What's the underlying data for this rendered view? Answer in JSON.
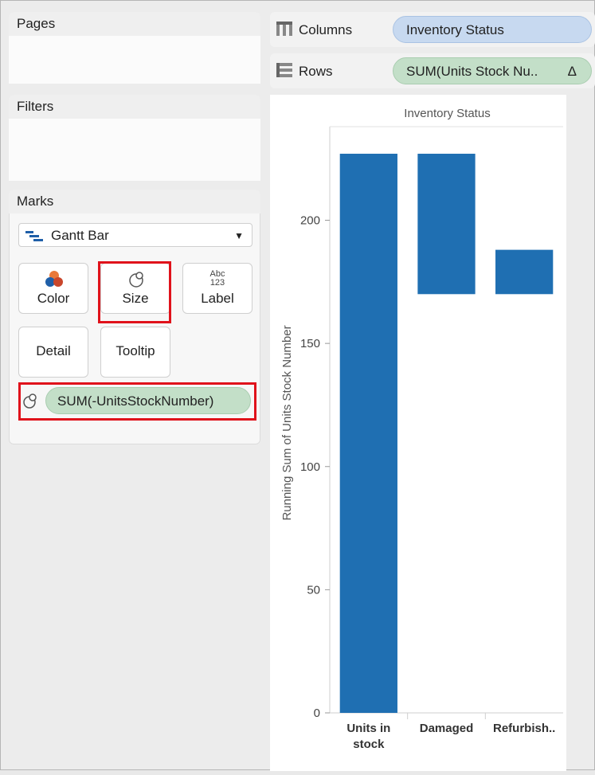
{
  "panels": {
    "pages_title": "Pages",
    "filters_title": "Filters",
    "marks_title": "Marks"
  },
  "marks": {
    "mark_type": "Gantt Bar",
    "buttons": {
      "color": "Color",
      "size": "Size",
      "label": "Label",
      "label_icon_top": "Abc",
      "label_icon_bottom": "123",
      "detail": "Detail",
      "tooltip": "Tooltip"
    },
    "size_field": "SUM(-UnitsStockNumber)",
    "color_icon_colors": [
      "#e8793a",
      "#1f5fa8"
    ]
  },
  "shelves": {
    "columns_label": "Columns",
    "columns_pill": "Inventory Status",
    "rows_label": "Rows",
    "rows_pill": "SUM(Units Stock Nu..",
    "rows_pill_delta": "Δ"
  },
  "highlight_color": "#e0121b",
  "chart_data": {
    "type": "bar",
    "subtype": "gantt",
    "title": "Inventory Status",
    "ylabel": "Running Sum of Units Stock Number",
    "xlabel": "",
    "categories": [
      "Units in stock",
      "Damaged",
      "Refurbish.."
    ],
    "category_lines": [
      [
        "Units in",
        "stock"
      ],
      [
        "Damaged"
      ],
      [
        "Refurbish.."
      ]
    ],
    "bars": [
      {
        "category": "Units in stock",
        "start": 0,
        "end": 227
      },
      {
        "category": "Damaged",
        "start": 170,
        "end": 227
      },
      {
        "category": "Refurbish..",
        "start": 170,
        "end": 188
      }
    ],
    "ylim": [
      0,
      238
    ],
    "yticks": [
      0,
      50,
      100,
      150,
      200
    ],
    "bar_color": "#1f6fb2",
    "grid": false
  }
}
